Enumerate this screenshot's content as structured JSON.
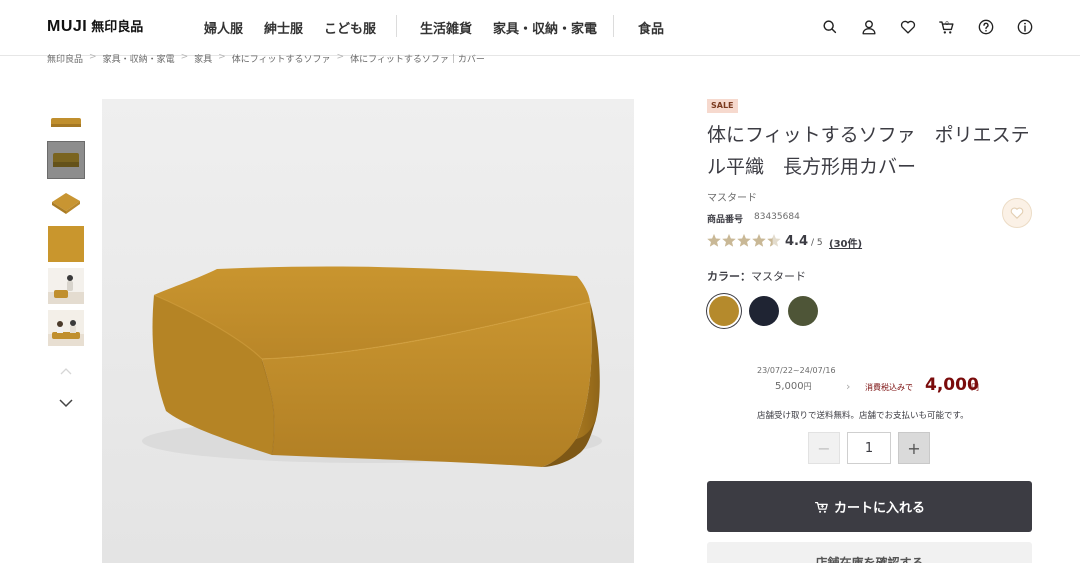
{
  "header": {
    "logo_en": "MUJI",
    "logo_jp": "無印良品",
    "nav": [
      "婦人服",
      "紳士服",
      "こども服",
      "生活雑貨",
      "家具・収納・家電",
      "食品"
    ],
    "cart_count": "0"
  },
  "breadcrumb": [
    "無印良品",
    "家具・収納・家電",
    "家具",
    "体にフィットするソファ",
    "体にフィットするソファ｜カバー"
  ],
  "product": {
    "badge": "SALE",
    "title": "体にフィットするソファ　ポリエステル平織　長方形用カバー",
    "variant": "マスタード",
    "code_label": "商品番号",
    "code_value": "83435684",
    "rating": "4.4",
    "rating_max": "/ 5",
    "rating_fraction": 0.88,
    "review_count": "(30件)",
    "color_label": "カラー：",
    "color_value": "マスタード",
    "swatches": [
      {
        "name": "マスタード",
        "color": "#b58a2c"
      },
      {
        "name": "ネイビー",
        "color": "#1f2433"
      },
      {
        "name": "カーキ",
        "color": "#4e5537"
      }
    ]
  },
  "price": {
    "period": "23/07/22~24/07/16",
    "old": "5,000",
    "old_yen": "円",
    "arrow": "›",
    "tax_label": "消費税込みで",
    "new": "4,000",
    "new_yen": "円",
    "store_note": "店舗受け取りで送料無料。店舗でお支払いも可能です。"
  },
  "quantity": {
    "minus": "−",
    "value": "1",
    "plus": "+"
  },
  "actions": {
    "cart": "カートに入れる",
    "store": "店舗在庫を確認する"
  },
  "colors": {
    "accent_dark": "#3c3c43",
    "sale_red": "#7a0b0b",
    "product_mustard": "#c08f2e"
  }
}
